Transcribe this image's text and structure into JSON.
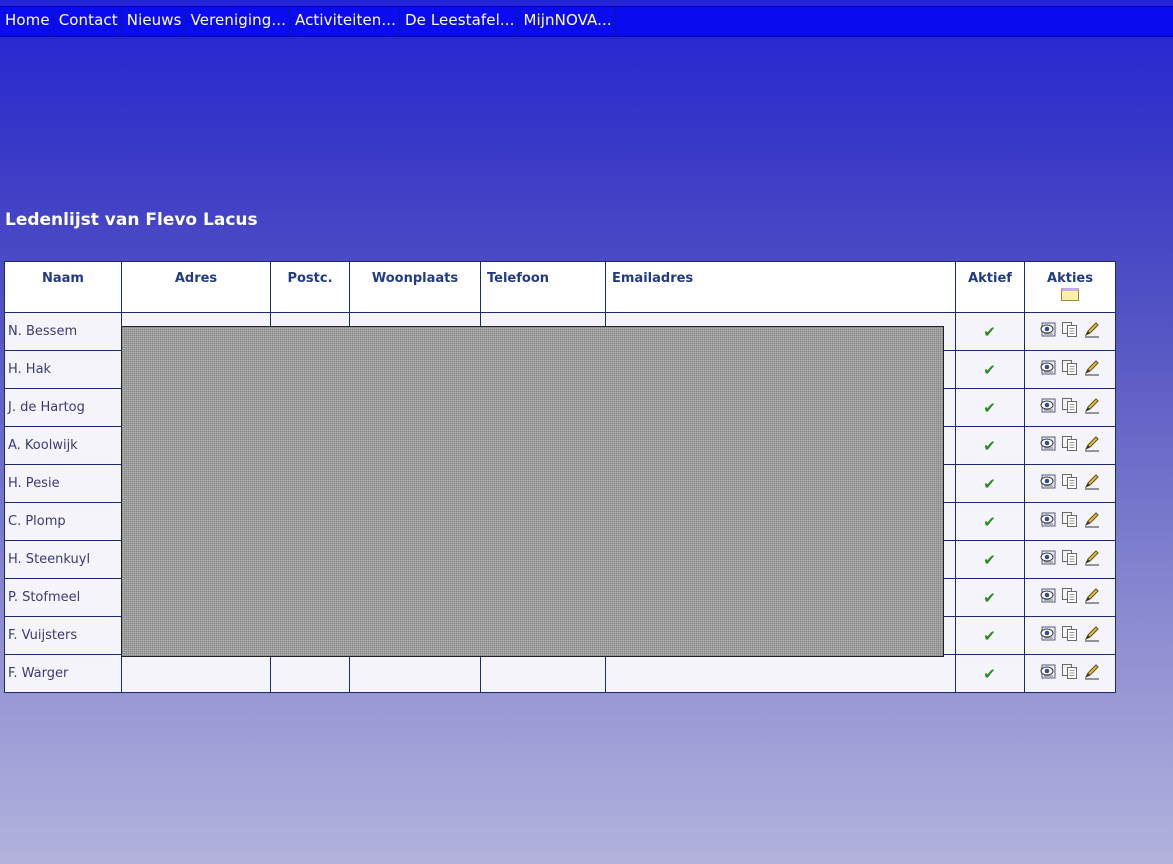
{
  "nav": {
    "items": [
      "Home",
      "Contact",
      "Nieuws",
      "Vereniging...",
      "Activiteiten...",
      "De Leestafel...",
      "MijnNOVA..."
    ]
  },
  "page": {
    "title": "Ledenlijst van Flevo Lacus"
  },
  "table": {
    "columns": [
      "Naam",
      "Adres",
      "Postc.",
      "Woonplaats",
      "Telefoon",
      "Emailadres",
      "Aktief",
      "Akties"
    ],
    "rows": [
      {
        "naam": "N. Bessem",
        "aktief": "✔"
      },
      {
        "naam": "H. Hak",
        "aktief": "✔"
      },
      {
        "naam": "J. de Hartog",
        "aktief": "✔"
      },
      {
        "naam": "A. Koolwijk",
        "aktief": "✔"
      },
      {
        "naam": "H. Pesie",
        "aktief": "✔"
      },
      {
        "naam": "C. Plomp",
        "aktief": "✔"
      },
      {
        "naam": "H. Steenkuyl",
        "aktief": "✔"
      },
      {
        "naam": "P. Stofmeel",
        "aktief": "✔"
      },
      {
        "naam": "F. Vuijsters",
        "aktief": "✔"
      },
      {
        "naam": "F. Warger",
        "aktief": "✔"
      }
    ]
  },
  "icons": {
    "header_action": "folder-icon",
    "row_actions": [
      "view-icon",
      "copy-icon",
      "edit-pencil-icon"
    ]
  },
  "colors": {
    "nav_bg": "#0b0bf0",
    "check": "#2b8a1e",
    "header_text": "#223c84"
  }
}
